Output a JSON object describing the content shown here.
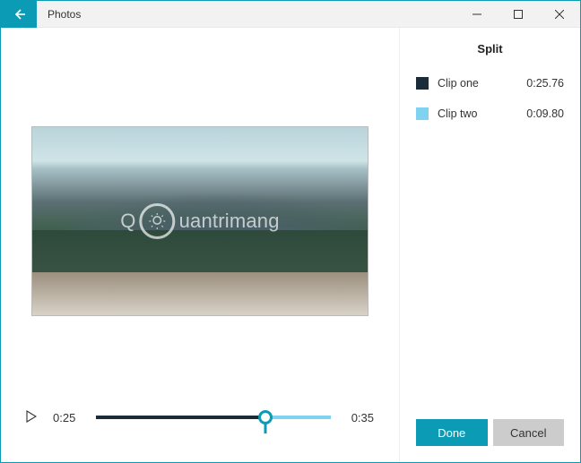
{
  "window": {
    "title": "Photos",
    "colors": {
      "accent": "#0b9bb5",
      "clip_one": "#1a2b3a",
      "clip_two": "#7fd3f0"
    }
  },
  "player": {
    "current_time": "0:25",
    "total_time": "0:35",
    "split_ratio_pct": 72
  },
  "panel": {
    "title": "Split",
    "clips": [
      {
        "label": "Clip one",
        "duration": "0:25.76"
      },
      {
        "label": "Clip two",
        "duration": "0:09.80"
      }
    ],
    "done_label": "Done",
    "cancel_label": "Cancel"
  },
  "watermark": {
    "text_left": "Q",
    "text_right": "uantrimang"
  }
}
